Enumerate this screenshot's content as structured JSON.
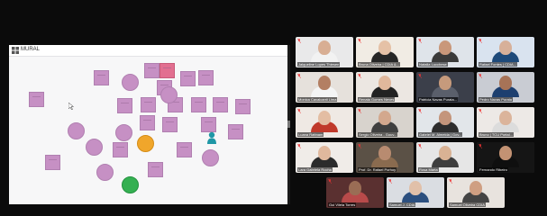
{
  "whiteboard": {
    "title": "MURAL",
    "logo_icon": "mural-logo-icon",
    "sticky_color": "#c690c4",
    "accent_colors": {
      "orange": "#f0a62b",
      "green": "#35b052",
      "pink": "#e26f90",
      "teal": "#1f97a6"
    }
  },
  "gallery": {
    "participants": [
      {
        "name": "Jalqueline Lopes Thiesen"
      },
      {
        "name": "Bruna Oliveira | CDIA &..."
      },
      {
        "name": "Natalia Lucchese"
      },
      {
        "name": "Rafael Fontes | CDIA..."
      },
      {
        "name": "Monica Cavalcanti Lima"
      },
      {
        "name": "Renata Gomes Neves"
      },
      {
        "name": "Patricia Navas Purata..."
      },
      {
        "name": "Pedro Navas Purata"
      },
      {
        "name": "Luana Rattnam"
      },
      {
        "name": "Sergio Oliveira - Gouv..."
      },
      {
        "name": "Gabriel M. Almeida | Gov..."
      },
      {
        "name": "Bruno | TCU Portal..."
      },
      {
        "name": "Lara Gabriela Rocha"
      },
      {
        "name": "Prof. Dr. Rafael Porhoy"
      },
      {
        "name": "Rosa Marta"
      },
      {
        "name": "Fernando Ribeiro"
      },
      {
        "name": "Gui Vilela Torres"
      },
      {
        "name": "Samuel J. CDIA"
      },
      {
        "name": "Samuel Oliveira CDIA"
      }
    ]
  }
}
